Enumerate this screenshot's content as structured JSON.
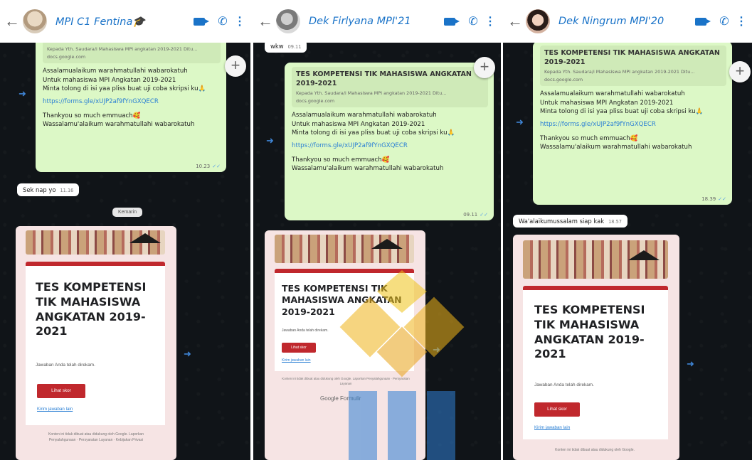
{
  "chats": [
    {
      "contact": "MPI C1 Fentina🎓",
      "message": {
        "preview_title": "",
        "preview_desc": "Kepada Yth. Saudara/i Mahasiswa MPI angkatan 2019-2021 Ditu...",
        "preview_domain": "docs.google.com",
        "lines": [
          "Assalamualaikum warahmatullahi wabarokatuh",
          "Untuk mahasiswa MPI Angkatan 2019-2021",
          "Minta tolong di isi yaa pliss buat uji coba skripsi ku🙏"
        ],
        "link": "https://forms.gle/xUJP2af9fYnGXQECR",
        "closing": [
          "Thankyou so much emmuach🥰",
          "Wassalamu'alaikum warahmatullahi wabarokatuh"
        ],
        "time": "10.23"
      },
      "reply": {
        "text": "Sek nap yo",
        "time": "11.16"
      },
      "date_chip": "Kemarin",
      "form": {
        "title": "TES KOMPETENSI TIK MAHASISWA ANGKATAN 2019-2021",
        "response": "Jawaban Anda telah direkam.",
        "button": "Lihat skor",
        "edit": "Kirim jawaban lain",
        "footer": "Konten ini tidak dibuat atau didukung oleh Google. Laporkan Penyalahgunaan · Persyaratan Layanan · Kebijakan Privasi",
        "brand": ""
      }
    },
    {
      "contact": "Dek Firlyana MPI'21",
      "top_reply": {
        "text": "wkw",
        "time": "09.11"
      },
      "message": {
        "preview_title": "TES KOMPETENSI TIK MAHASISWA ANGKATAN 2019-2021",
        "preview_desc": "Kepada Yth. Saudara/i Mahasiswa MPI angkatan 2019-2021 Ditu...",
        "preview_domain": "docs.google.com",
        "lines": [
          "Assalamualaikum warahmatullahi wabarokatuh",
          "Untuk mahasiswa MPI Angkatan 2019-2021",
          "Minta tolong di isi yaa pliss buat uji coba skripsi ku🙏"
        ],
        "link": "https://forms.gle/xUJP2af9fYnGXQECR",
        "closing": [
          "Thankyou so much emmuach🥰",
          "Wassalamu'alaikum warahmatullahi wabarokatuh"
        ],
        "time": "09.11"
      },
      "form": {
        "title": "TES KOMPETENSI TIK MAHASISWA ANGKATAN 2019-2021",
        "response": "Jawaban Anda telah direkam.",
        "button": "Lihat skor",
        "edit": "Kirim jawaban lain",
        "footer": "Konten ini tidak dibuat atau didukung oleh Google. Laporkan Penyalahgunaan · Persyaratan Layanan",
        "brand": "Google Formulir"
      }
    },
    {
      "contact": "Dek Ningrum MPI'20",
      "message": {
        "preview_title": "TES KOMPETENSI TIK MAHASISWA ANGKATAN 2019-2021",
        "preview_desc": "Kepada Yth. Saudara/i Mahasiswa MPI angkatan 2019-2021 Ditu...",
        "preview_domain": "docs.google.com",
        "lines": [
          "Assalamualaikum warahmatullahi wabarokatuh",
          "Untuk mahasiswa MPI Angkatan 2019-2021",
          "Minta tolong di isi yaa pliss buat uji coba skripsi ku🙏"
        ],
        "link": "https://forms.gle/xUJP2af9fYnGXQECR",
        "closing": [
          "Thankyou so much emmuach🥰",
          "Wassalamu'alaikum warahmatullahi wabarokatuh"
        ],
        "time": "18.39"
      },
      "reply": {
        "text": "Wa'alaikumussalam siap kak",
        "time": "18.57"
      },
      "form": {
        "title": "TES KOMPETENSI TIK MAHASISWA ANGKATAN 2019-2021",
        "response": "Jawaban Anda telah direkam.",
        "button": "Lihat skor",
        "edit": "Kirim jawaban lain",
        "footer": "Konten ini tidak dibuat atau didukung oleh Google.",
        "brand": ""
      }
    }
  ],
  "icons": [
    "back-arrow-icon",
    "video-call-icon",
    "phone-icon",
    "more-options-icon",
    "add-icon",
    "forward-icon"
  ],
  "colors": {
    "accent": "#1a73c8",
    "bubble_out": "#dcf8c6",
    "form_red": "#c0282d",
    "chat_bg": "#101418"
  }
}
